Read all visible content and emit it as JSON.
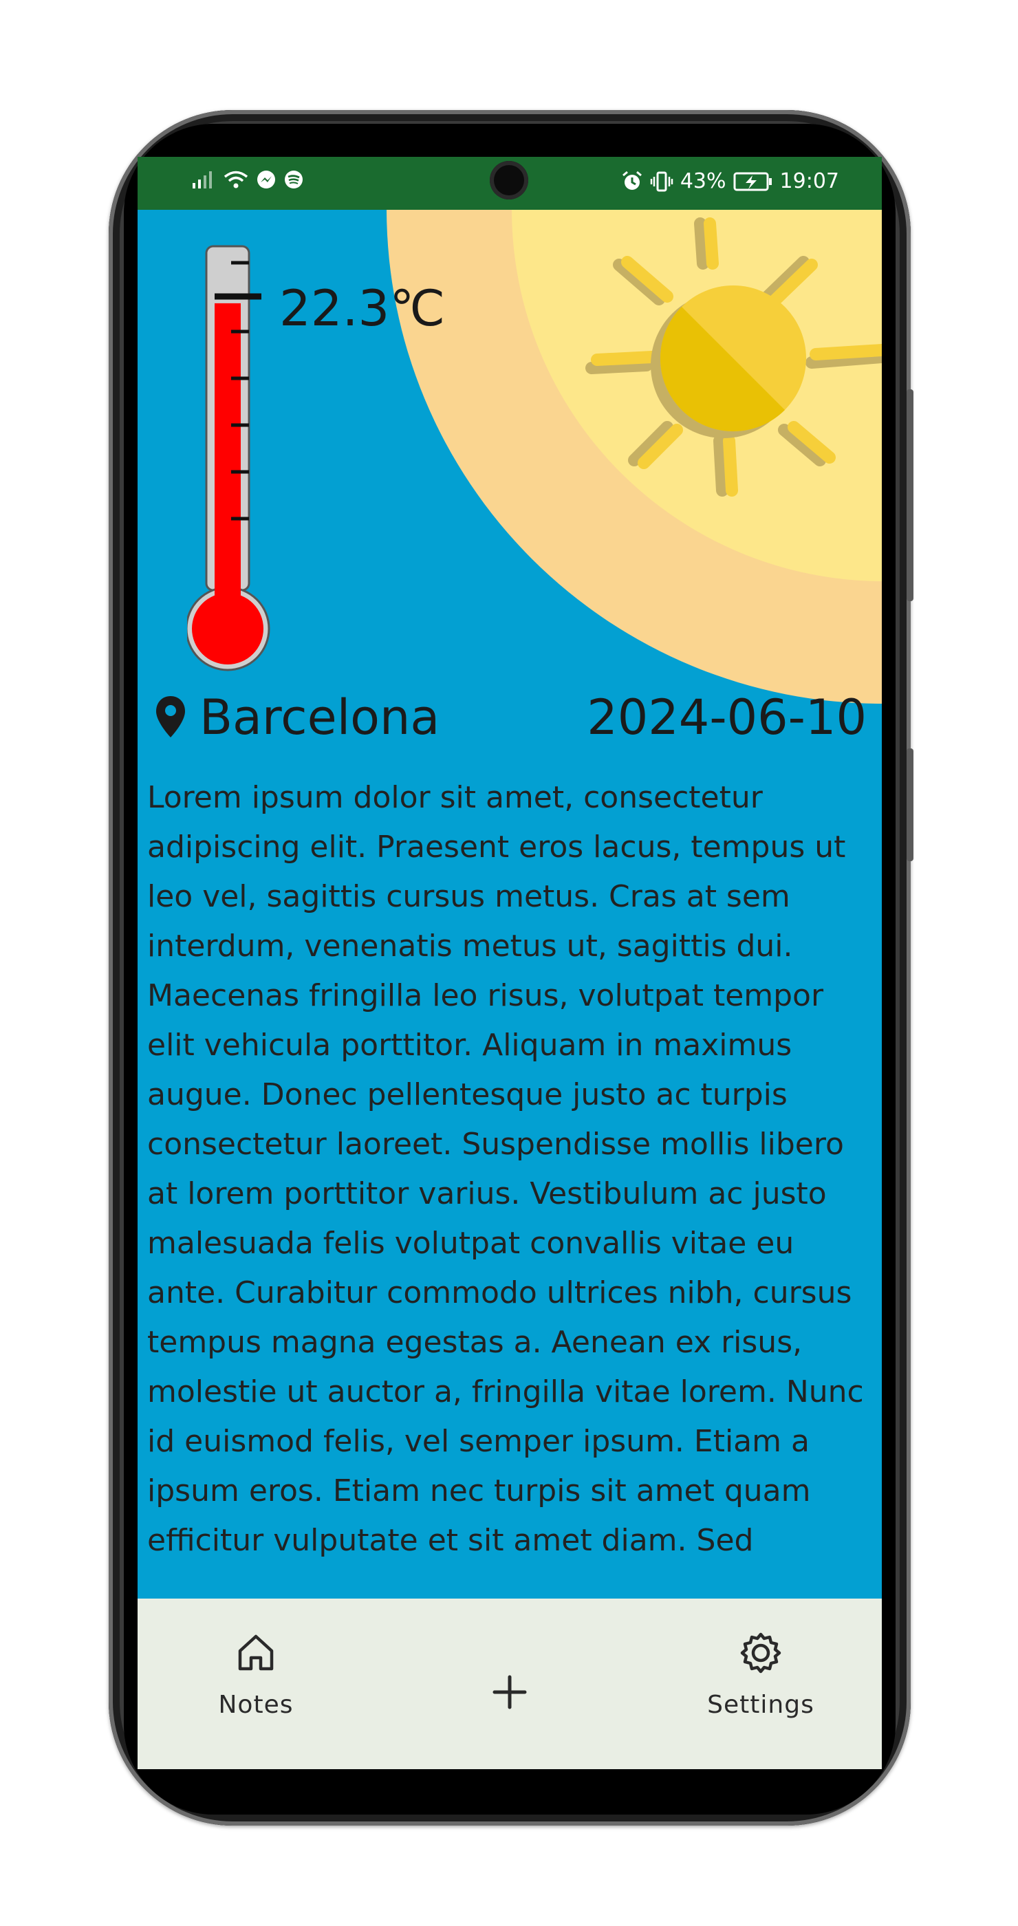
{
  "status_bar": {
    "battery": "43%",
    "time": "19:07",
    "bg_color": "#1a6b2f",
    "icons_left": [
      "signal-icon",
      "wifi-icon",
      "messenger-icon",
      "spotify-icon"
    ],
    "icons_right": [
      "alarm-icon",
      "vibrate-icon",
      "battery-charging-icon"
    ]
  },
  "weather": {
    "temperature": "22.3℃",
    "thermometer_fill_fraction": 0.84,
    "location": "Barcelona",
    "date": "2024-06-10"
  },
  "note": {
    "text": "Lorem ipsum dolor sit amet, consectetur adipiscing elit. Praesent eros lacus, tempus ut leo vel, sagittis cursus metus. Cras at sem interdum, venenatis metus ut, sagittis dui. Maecenas fringilla leo risus, volutpat tempor elit vehicula porttitor. Aliquam in maximus augue. Donec pellentesque justo ac turpis consectetur laoreet. Suspendisse mollis libero at lorem porttitor varius. Vestibulum ac justo malesuada felis volutpat convallis vitae eu ante. Curabitur commodo ultrices nibh, cursus tempus magna egestas a. Aenean ex risus, molestie ut auctor a, fringilla vitae lorem. Nunc id euismod felis, vel semper ipsum. Etiam a ipsum eros. Etiam nec turpis sit amet quam efficitur vulputate et sit amet diam. Sed"
  },
  "bottom_nav": {
    "notes_label": "Notes",
    "settings_label": "Settings",
    "add_icon": "plus-icon"
  },
  "colors": {
    "screen_bg": "#03A0D2",
    "nav_bg": "#e9eee4",
    "sun": "#F9C900",
    "thermo_fill": "#ff0000"
  }
}
